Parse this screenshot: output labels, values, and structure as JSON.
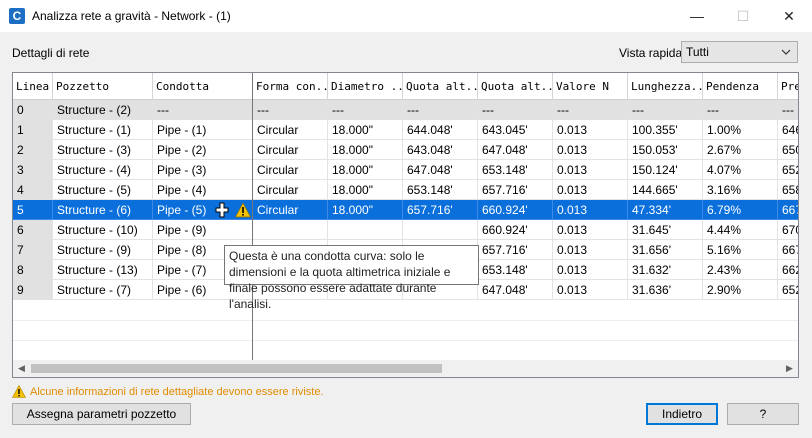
{
  "window": {
    "title": "Analizza rete a gravità - Network - (1)",
    "app_icon": "C",
    "minimize": "—",
    "maximize": "☐",
    "close": "✕"
  },
  "section_label": "Dettagli di rete",
  "quick_view": {
    "label": "Vista rapida",
    "value": "Tutti"
  },
  "table": {
    "columns": [
      "Linea",
      "Pozzetto",
      "Condotta",
      "Forma con...",
      "Diametro ...",
      "Quota alt...",
      "Quota alt...",
      "Valore N",
      "Lunghezza...",
      "Pendenza",
      "Pre"
    ],
    "rows": [
      [
        "0",
        "Structure - (2)",
        "---",
        "---",
        "---",
        "---",
        "---",
        "---",
        "---",
        "---",
        "---"
      ],
      [
        "1",
        "Structure - (1)",
        "Pipe - (1)",
        "Circular",
        "18.000\"",
        "644.048'",
        "643.045'",
        "0.013",
        "100.355'",
        "1.00%",
        "646"
      ],
      [
        "2",
        "Structure - (3)",
        "Pipe - (2)",
        "Circular",
        "18.000\"",
        "643.048'",
        "647.048'",
        "0.013",
        "150.053'",
        "2.67%",
        "650"
      ],
      [
        "3",
        "Structure - (4)",
        "Pipe - (3)",
        "Circular",
        "18.000\"",
        "647.048'",
        "653.148'",
        "0.013",
        "150.124'",
        "4.07%",
        "652"
      ],
      [
        "4",
        "Structure - (5)",
        "Pipe - (4)",
        "Circular",
        "18.000\"",
        "653.148'",
        "657.716'",
        "0.013",
        "144.665'",
        "3.16%",
        "658"
      ],
      [
        "5",
        "Structure - (6)",
        "Pipe - (5)",
        "Circular",
        "18.000\"",
        "657.716'",
        "660.924'",
        "0.013",
        "47.334'",
        "6.79%",
        "667"
      ],
      [
        "6",
        "Structure - (10)",
        "Pipe - (9)",
        "",
        "",
        "",
        "660.924'",
        "0.013",
        "31.645'",
        "4.44%",
        "670"
      ],
      [
        "7",
        "Structure - (9)",
        "Pipe - (8)",
        "",
        "",
        "",
        "657.716'",
        "0.013",
        "31.656'",
        "5.16%",
        "667"
      ],
      [
        "8",
        "Structure - (13)",
        "Pipe - (7)",
        "",
        "",
        "",
        "653.148'",
        "0.013",
        "31.632'",
        "2.43%",
        "662"
      ],
      [
        "9",
        "Structure - (7)",
        "Pipe - (6)",
        "",
        "",
        "",
        "647.048'",
        "0.013",
        "31.636'",
        "2.90%",
        "652"
      ]
    ],
    "selected_row": 5
  },
  "tooltip": "Questa è una condotta curva: solo le dimensioni e la quota altimetrica iniziale e finale possono essere adattate durante l'analisi.",
  "notice": "Alcune informazioni di rete dettagliate devono essere riviste.",
  "buttons": {
    "assign": "Assegna parametri pozzetto",
    "back": "Indietro",
    "help": "?"
  },
  "colors": {
    "selection": "#0a6fdb",
    "warning": "#f2c200",
    "notice_text": "#e08c00"
  },
  "icons": {
    "warning": "warning-icon",
    "cursor": "move-cursor-icon",
    "app": "civil3d-icon"
  }
}
